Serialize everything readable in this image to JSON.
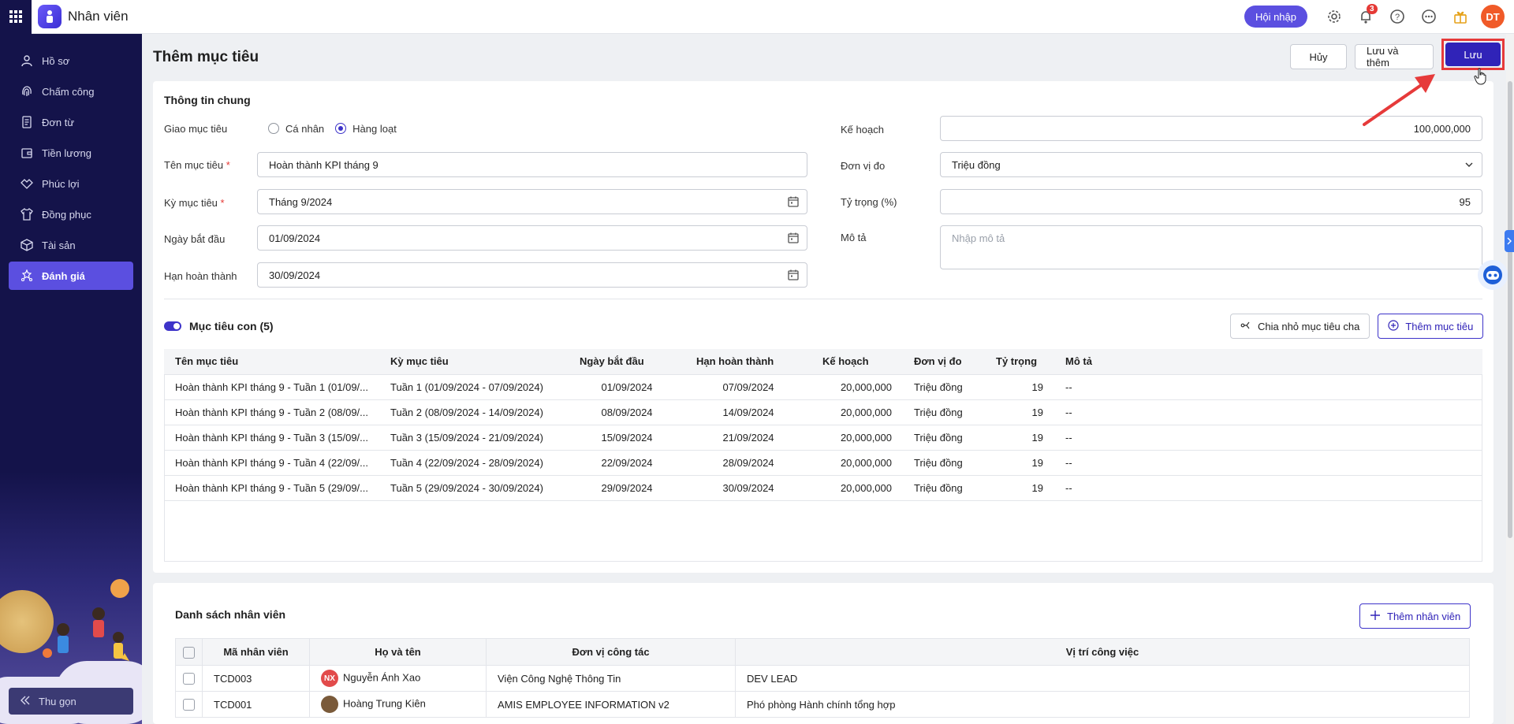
{
  "app": {
    "name": "Nhân viên"
  },
  "topbar": {
    "integrate_label": "Hội nhập",
    "notification_count": "3",
    "user_initials": "DT"
  },
  "sidebar": {
    "items": [
      {
        "label": "Hồ sơ",
        "icon": "person-icon"
      },
      {
        "label": "Chấm công",
        "icon": "fingerprint-icon"
      },
      {
        "label": "Đơn từ",
        "icon": "document-icon"
      },
      {
        "label": "Tiền lương",
        "icon": "wallet-icon"
      },
      {
        "label": "Phúc lợi",
        "icon": "handshake-icon"
      },
      {
        "label": "Đồng phục",
        "icon": "shirt-icon"
      },
      {
        "label": "Tài sản",
        "icon": "box-icon"
      },
      {
        "label": "Đánh giá",
        "icon": "star-people-icon",
        "active": true
      }
    ],
    "collapse_label": "Thu gọn"
  },
  "page": {
    "title": "Thêm mục tiêu",
    "cancel_label": "Hủy",
    "save_add_label": "Lưu và thêm",
    "save_label": "Lưu"
  },
  "general": {
    "title": "Thông tin chung",
    "assign_label": "Giao mục tiêu",
    "assign_options": [
      "Cá nhân",
      "Hàng loạt"
    ],
    "name_label": "Tên mục tiêu",
    "name_value": "Hoàn thành KPI tháng 9",
    "period_label": "Kỳ mục tiêu",
    "period_value": "Tháng 9/2024",
    "start_label": "Ngày bắt đầu",
    "start_value": "01/09/2024",
    "deadline_label": "Hạn hoàn thành",
    "deadline_value": "30/09/2024",
    "plan_label": "Kế hoạch",
    "plan_value": "100,000,000",
    "unit_label": "Đơn vị đo",
    "unit_value": "Triệu đồng",
    "weight_label": "Tỷ trọng (%)",
    "weight_value": "95",
    "desc_label": "Mô tả",
    "desc_placeholder": "Nhập mô tả"
  },
  "subgoals": {
    "title": "Mục tiêu con (5)",
    "split_label": "Chia nhỏ mục tiêu cha",
    "add_label": "Thêm mục tiêu",
    "columns": [
      "Tên mục tiêu",
      "Kỳ mục tiêu",
      "Ngày bắt đầu",
      "Hạn hoàn thành",
      "Kế hoạch",
      "Đơn vị đo",
      "Tỷ trọng",
      "Mô tả"
    ],
    "rows": [
      [
        "Hoàn thành KPI tháng 9 - Tuần 1 (01/09/...",
        "Tuần 1 (01/09/2024 - 07/09/2024)",
        "01/09/2024",
        "07/09/2024",
        "20,000,000",
        "Triệu đồng",
        "19",
        "--"
      ],
      [
        "Hoàn thành KPI tháng 9 - Tuần 2 (08/09/...",
        "Tuần 2 (08/09/2024 - 14/09/2024)",
        "08/09/2024",
        "14/09/2024",
        "20,000,000",
        "Triệu đồng",
        "19",
        "--"
      ],
      [
        "Hoàn thành KPI tháng 9 - Tuần 3 (15/09/...",
        "Tuần 3 (15/09/2024 - 21/09/2024)",
        "15/09/2024",
        "21/09/2024",
        "20,000,000",
        "Triệu đồng",
        "19",
        "--"
      ],
      [
        "Hoàn thành KPI tháng 9 - Tuần 4 (22/09/...",
        "Tuần 4 (22/09/2024 - 28/09/2024)",
        "22/09/2024",
        "28/09/2024",
        "20,000,000",
        "Triệu đồng",
        "19",
        "--"
      ],
      [
        "Hoàn thành KPI tháng 9 - Tuần 5 (29/09/...",
        "Tuần 5 (29/09/2024 - 30/09/2024)",
        "29/09/2024",
        "30/09/2024",
        "20,000,000",
        "Triệu đồng",
        "19",
        "--"
      ]
    ]
  },
  "employees": {
    "title": "Danh sách nhân viên",
    "add_label": "Thêm nhân viên",
    "columns": [
      "Mã nhân viên",
      "Họ và tên",
      "Đơn vị công tác",
      "Vị trí công việc"
    ],
    "rows": [
      {
        "code": "TCD003",
        "initials": "NX",
        "name": "Nguyễn Ánh Xao",
        "unit": "Viện Công Nghệ Thông Tin",
        "position": "DEV LEAD"
      },
      {
        "code": "TCD001",
        "initials": "",
        "name": "Hoàng Trung Kiên",
        "unit": "AMIS EMPLOYEE INFORMATION v2",
        "position": "Phó phòng Hành chính tổng hợp"
      }
    ]
  }
}
